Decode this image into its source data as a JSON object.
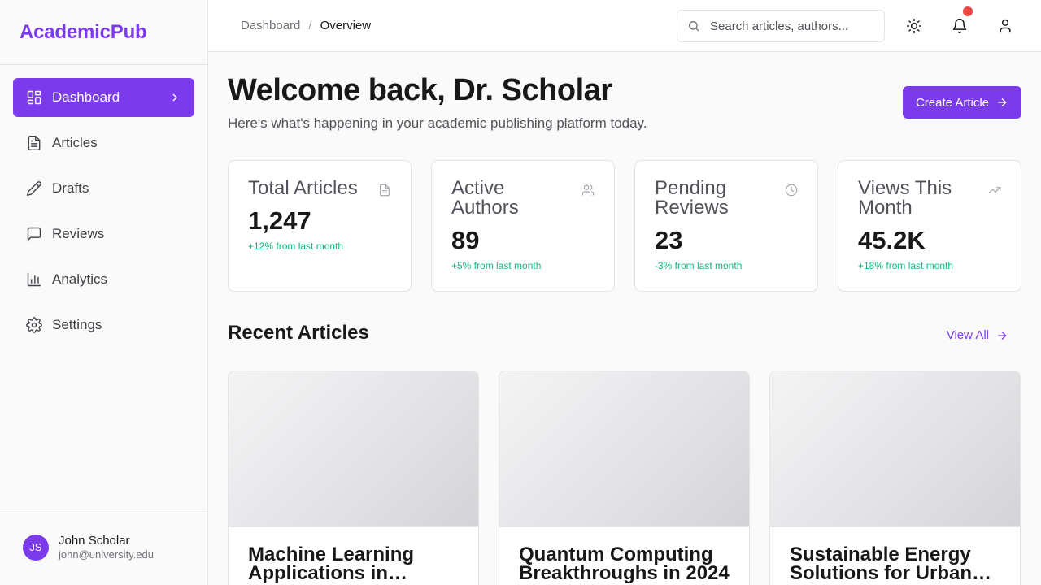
{
  "brand": {
    "name": "AcademicPub",
    "accent": "#7c3aed"
  },
  "sidebar": {
    "items": [
      {
        "label": "Dashboard",
        "icon": "dashboard-icon",
        "active": true
      },
      {
        "label": "Articles",
        "icon": "file-text-icon"
      },
      {
        "label": "Drafts",
        "icon": "pen-icon"
      },
      {
        "label": "Reviews",
        "icon": "message-square-icon"
      },
      {
        "label": "Analytics",
        "icon": "bar-chart-icon"
      },
      {
        "label": "Settings",
        "icon": "gear-icon"
      }
    ],
    "user": {
      "initials": "JS",
      "name": "John Scholar",
      "email": "john@university.edu"
    }
  },
  "header": {
    "breadcrumb": {
      "parent": "Dashboard",
      "separator": "/",
      "current": "Overview"
    },
    "search_placeholder": "Search articles, authors...",
    "icons": [
      "sun-icon",
      "bell-icon",
      "user-icon"
    ]
  },
  "main": {
    "welcome": "Welcome back, Dr. Scholar",
    "subtitle": "Here's what's happening in your academic publishing platform today.",
    "create_button": "Create Article",
    "stats": [
      {
        "title": "Total Articles",
        "value": "1,247",
        "change": "+12% from last month",
        "icon": "file-icon"
      },
      {
        "title": "Active Authors",
        "value": "89",
        "change": "+5% from last month",
        "icon": "users-icon"
      },
      {
        "title": "Pending Reviews",
        "value": "23",
        "change": "-3% from last month",
        "icon": "clock-icon"
      },
      {
        "title": "Views This Month",
        "value": "45.2K",
        "change": "+18% from last month",
        "icon": "trending-up-icon"
      }
    ],
    "recent_title": "Recent Articles",
    "view_all": "View All",
    "articles": [
      {
        "title": "Machine Learning Applications in Climate Science"
      },
      {
        "title": "Quantum Computing Breakthroughs in 2024"
      },
      {
        "title": "Sustainable Energy Solutions for Urban Development"
      }
    ]
  },
  "colors": {
    "positive": "#10b981",
    "notification": "#ef4444"
  }
}
